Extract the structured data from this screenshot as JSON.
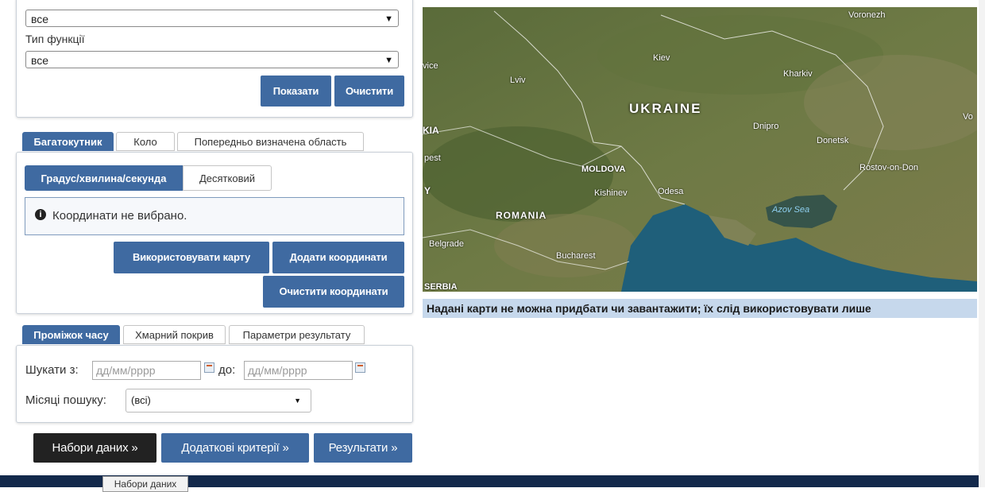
{
  "filters": {
    "first_select_value": "все",
    "function_type_label": "Тип функції",
    "function_type_value": "все",
    "show_button": "Показати",
    "clear_button": "Очистити"
  },
  "area": {
    "tabs": [
      {
        "label": "Багатокутник",
        "active": true
      },
      {
        "label": "Коло",
        "active": false
      },
      {
        "label": "Попередньо визначена область",
        "active": false
      }
    ],
    "format_tabs": [
      {
        "label": "Градус/хвилина/секунда",
        "active": true
      },
      {
        "label": "Десятковий",
        "active": false
      }
    ],
    "info_text": "Координати не вибрано.",
    "use_map_button": "Використовувати карту",
    "add_coords_button": "Додати координати",
    "clear_coords_button": "Очистити координати"
  },
  "time": {
    "tabs": [
      {
        "label": "Проміжок часу",
        "active": true
      },
      {
        "label": "Хмарний покрив",
        "active": false
      },
      {
        "label": "Параметри результату",
        "active": false
      }
    ],
    "search_from_label": "Шукати з:",
    "from_placeholder": "дд/мм/рррр",
    "to_label": "до:",
    "to_placeholder": "дд/мм/рррр",
    "months_label": "Місяці пошуку:",
    "months_value": "(всі)"
  },
  "nav": {
    "datasets_button": "Набори даних »",
    "extra_criteria_button": "Додаткові критерії »",
    "results_button": "Результати »",
    "tooltip": "Набори даних"
  },
  "map": {
    "labels": {
      "voronezh": "Voronezh",
      "kiev": "Kiev",
      "kharkiv": "Kharkiv",
      "lviv": "Lviv",
      "ukraine": "UKRAINE",
      "dnipro": "Dnipro",
      "donetsk": "Donetsk",
      "rostov": "Rostov-on-Don",
      "moldova": "MOLDOVA",
      "kishinev": "Kishinev",
      "odesa": "Odesa",
      "azov": "Azov Sea",
      "romania": "ROMANIA",
      "belgrade": "Belgrade",
      "bucharest": "Bucharest",
      "serbia": "SERBIA",
      "pest": "pest",
      "kia": "KIA",
      "vice": "vice",
      "y": "Y",
      "vo": "Vo"
    },
    "caption": "Надані карти не можна придбати чи завантажити; їх слід використовувати лише"
  },
  "colors": {
    "accent": "#3f6aa1",
    "dark_button": "#222222",
    "bottom_bar": "#13294b"
  }
}
